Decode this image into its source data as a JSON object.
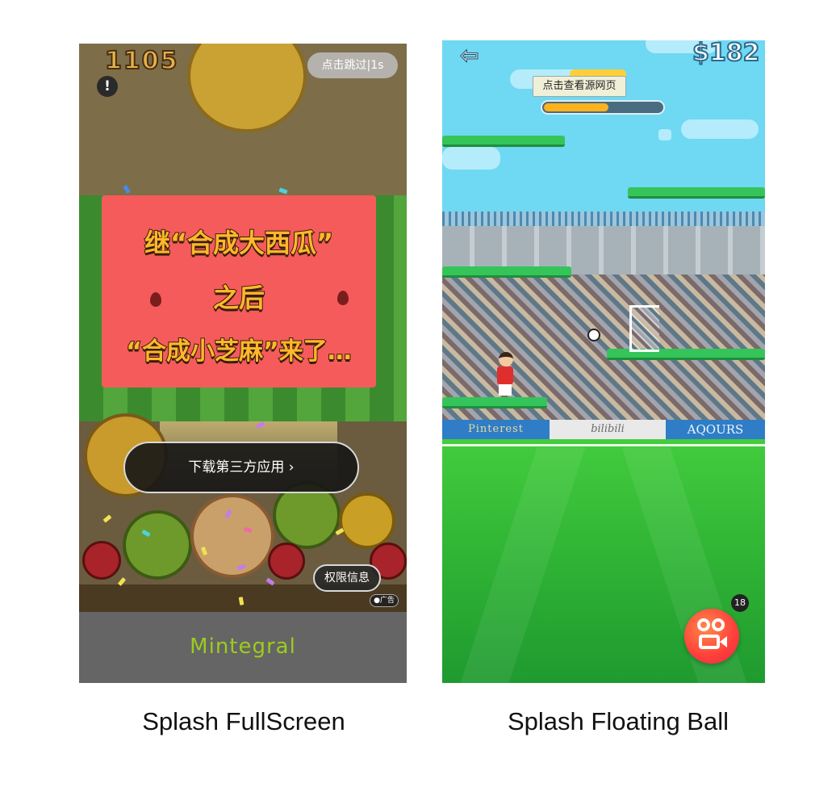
{
  "panels": {
    "fullscreen": {
      "caption": "Splash FullScreen",
      "score": "1105",
      "skip_label": "点击跳过|1s",
      "alert_icon": "!",
      "headline_line1": "继“合成大西瓜”",
      "headline_line2": "之后",
      "headline_line3": "“合成小芝麻”来了…",
      "download_label": "下载第三方应用 ›",
      "permission_label": "权限信息",
      "ad_badge": "●广告",
      "brand": "Mintegral",
      "brand_color": "#9ccc1c"
    },
    "floating": {
      "caption": "Splash Floating Ball",
      "money": "$182",
      "back_icon": "arrow-left-icon",
      "tooltip": "点击查看源网页",
      "level_fill": 0.55,
      "banners": [
        "Pinterest",
        "bilibili",
        "AQOURS"
      ],
      "ball_badge": "18",
      "ball_icon": "kuaishou-camera-icon",
      "ball_color": "#ff4a3a"
    }
  }
}
